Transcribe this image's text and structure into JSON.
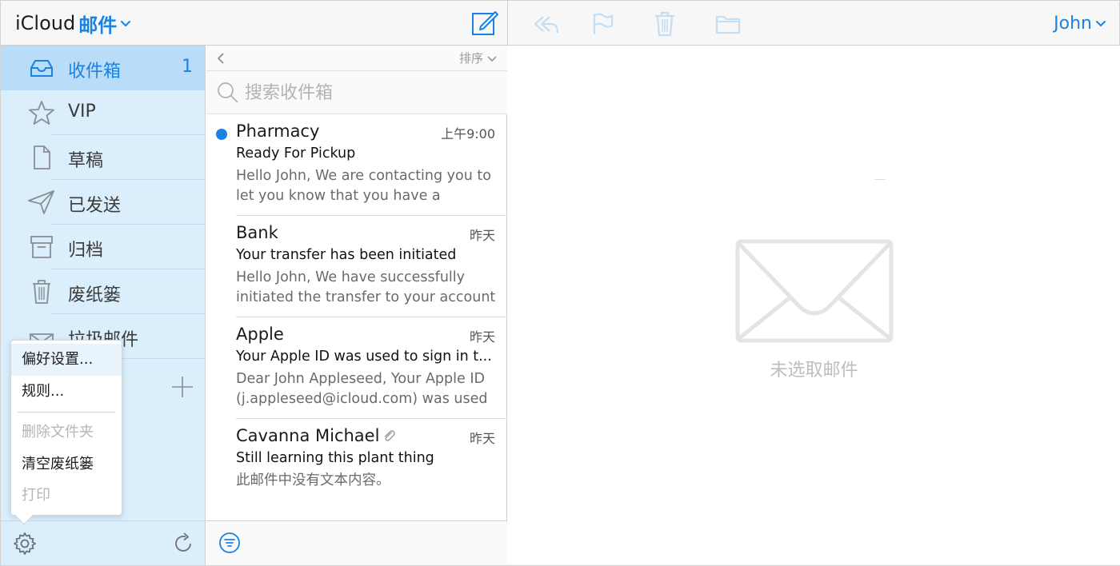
{
  "header": {
    "brand_primary": "iCloud",
    "brand_secondary": "邮件",
    "user_name": "John"
  },
  "toolbar_icons": [
    "compose-icon",
    "reply-icon",
    "flag-icon",
    "trash-icon",
    "folder-icon"
  ],
  "sidebar": {
    "mailboxes": [
      {
        "label": "收件箱",
        "count": "1",
        "icon": "inbox-icon",
        "selected": true
      },
      {
        "label": "VIP",
        "count": "",
        "icon": "star-icon",
        "selected": false
      },
      {
        "label": "草稿",
        "count": "",
        "icon": "document-icon",
        "selected": false
      },
      {
        "label": "已发送",
        "count": "",
        "icon": "paper-plane-icon",
        "selected": false
      },
      {
        "label": "归档",
        "count": "",
        "icon": "archive-box-icon",
        "selected": false
      },
      {
        "label": "废纸篓",
        "count": "",
        "icon": "trash-icon",
        "selected": false
      },
      {
        "label": "垃圾邮件",
        "count": "",
        "icon": "junk-icon",
        "selected": false
      }
    ]
  },
  "settings_menu": {
    "items": [
      {
        "label": "偏好设置...",
        "enabled": true,
        "highlighted": true
      },
      {
        "label": "规则...",
        "enabled": true,
        "highlighted": false
      },
      {
        "label": "删除文件夹",
        "enabled": false,
        "highlighted": false
      },
      {
        "label": "清空废纸篓",
        "enabled": true,
        "highlighted": false
      },
      {
        "label": "打印",
        "enabled": false,
        "highlighted": false
      }
    ]
  },
  "message_list": {
    "sort_label": "排序",
    "search_placeholder": "搜索收件箱",
    "messages": [
      {
        "sender": "Pharmacy",
        "time": "上午9:00",
        "subject": "Ready For Pickup",
        "preview": "Hello John, We are contacting you to let you know that you have a",
        "unread": true,
        "attachment": false
      },
      {
        "sender": "Bank",
        "time": "昨天",
        "subject": "Your transfer has been initiated",
        "preview": "Hello John, We have successfully initiated the transfer to your account",
        "unread": false,
        "attachment": false
      },
      {
        "sender": "Apple",
        "time": "昨天",
        "subject": "Your Apple ID was used to sign in t...",
        "preview": "Dear John Appleseed, Your Apple ID (j.appleseed@icloud.com) was used",
        "unread": false,
        "attachment": false
      },
      {
        "sender": "Cavanna Michael",
        "time": "昨天",
        "subject": "Still learning this plant thing",
        "preview": "此邮件中没有文本内容。",
        "unread": false,
        "attachment": true
      }
    ]
  },
  "reader": {
    "empty_label": "未选取邮件"
  },
  "colors": {
    "accent": "#1a82e2",
    "sidebar_bg": "#dbeefc",
    "sidebar_selected": "#b9dcf8",
    "toolbar_disabled": "#c3dff6"
  }
}
